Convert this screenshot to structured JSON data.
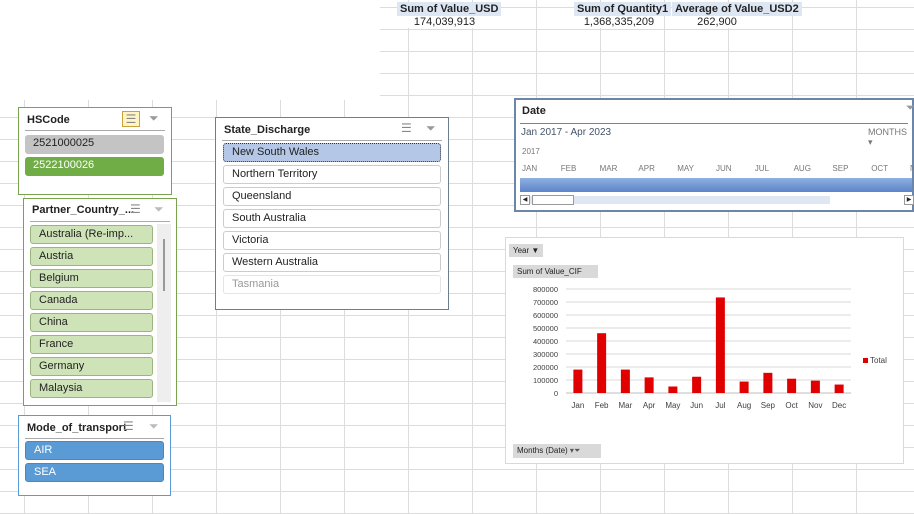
{
  "summary": [
    {
      "header": "Sum of Value_USD",
      "value": "174,039,913"
    },
    {
      "header": "Sum of Quantity1",
      "value": "1,368,335,209"
    },
    {
      "header": "Average of Value_USD2",
      "value": "262,900"
    }
  ],
  "hscode": {
    "title": "HSCode",
    "items": [
      "2521000025",
      "2522100026"
    ],
    "selected": "2522100026"
  },
  "partner": {
    "title": "Partner_Country_...",
    "items": [
      "Australia (Re-imp...",
      "Austria",
      "Belgium",
      "Canada",
      "China",
      "France",
      "Germany",
      "Malaysia"
    ]
  },
  "state": {
    "title": "State_Discharge",
    "items": [
      "New South Wales",
      "Northern Territory",
      "Queensland",
      "South Australia",
      "Victoria",
      "Western Australia",
      "Tasmania"
    ],
    "active": "New South Wales",
    "disabled": "Tasmania"
  },
  "transport": {
    "title": "Mode_of_transport",
    "items": [
      "AIR",
      "SEA"
    ]
  },
  "timeline": {
    "title": "Date",
    "range": "Jan 2017 - Apr 2023",
    "level": "MONTHS",
    "year": "2017",
    "months": [
      "JAN",
      "FEB",
      "MAR",
      "APR",
      "MAY",
      "JUN",
      "JUL",
      "AUG",
      "SEP",
      "OCT",
      "N"
    ]
  },
  "colors": {
    "bar": "#e00000",
    "slicer_green": "#70ad47",
    "slicer_blue": "#5b9bd5"
  },
  "chart_data": {
    "type": "bar",
    "field_buttons": {
      "filter": "Year",
      "value": "Sum of Value_CIF",
      "axis": "Months (Date)"
    },
    "categories": [
      "Jan",
      "Feb",
      "Mar",
      "Apr",
      "May",
      "Jun",
      "Jul",
      "Aug",
      "Sep",
      "Oct",
      "Nov",
      "Dec"
    ],
    "series": [
      {
        "name": "Total",
        "values": [
          180000,
          460000,
          180000,
          120000,
          50000,
          125000,
          735000,
          88000,
          155000,
          110000,
          95000,
          65000
        ]
      }
    ],
    "yticks": [
      "0",
      "100000",
      "200000",
      "300000",
      "400000",
      "500000",
      "600000",
      "700000",
      "800000"
    ],
    "ylim": [
      0,
      800000
    ],
    "grid": true,
    "legend": "right"
  }
}
